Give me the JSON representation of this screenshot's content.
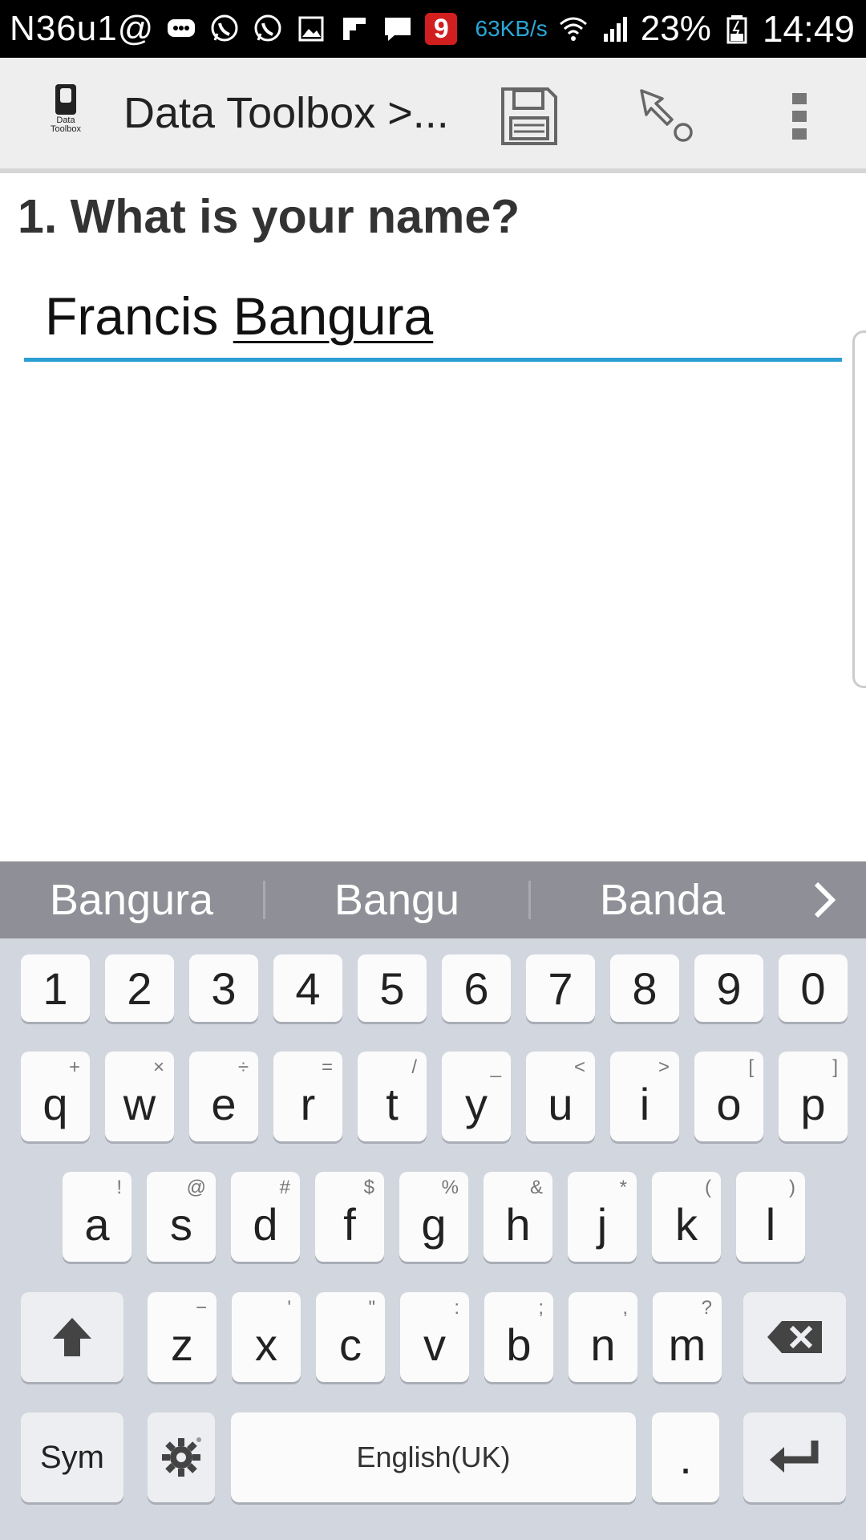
{
  "status_bar": {
    "carrier": "N36u1@",
    "net_speed": "63KB/s",
    "battery": "23%",
    "time": "14:49",
    "notif_badge": "9",
    "icons": [
      "chat-bubble-icon",
      "whatsapp-icon",
      "whatsapp-icon",
      "image-icon",
      "flipboard-icon",
      "message-icon",
      "app-9-icon",
      "wifi-icon",
      "signal-icon",
      "battery-icon"
    ]
  },
  "app_bar": {
    "logo_caption": "Data Toolbox",
    "title": "Data Toolbox >...",
    "actions": [
      "save-icon",
      "pointer-icon",
      "more-vert-icon"
    ]
  },
  "form": {
    "question": "1. What is your name?",
    "answer_first": "Francis",
    "answer_last": "Bangura",
    "accent_color": "#2b9fd3"
  },
  "suggestions": [
    "Bangura",
    "Bangu",
    "Banda"
  ],
  "keyboard": {
    "numbers": [
      "1",
      "2",
      "3",
      "4",
      "5",
      "6",
      "7",
      "8",
      "9",
      "0"
    ],
    "row1": [
      {
        "k": "q",
        "h": "+"
      },
      {
        "k": "w",
        "h": "×"
      },
      {
        "k": "e",
        "h": "÷"
      },
      {
        "k": "r",
        "h": "="
      },
      {
        "k": "t",
        "h": "/"
      },
      {
        "k": "y",
        "h": "_"
      },
      {
        "k": "u",
        "h": "<"
      },
      {
        "k": "i",
        "h": ">"
      },
      {
        "k": "o",
        "h": "["
      },
      {
        "k": "p",
        "h": "]"
      }
    ],
    "row2": [
      {
        "k": "a",
        "h": "!"
      },
      {
        "k": "s",
        "h": "@"
      },
      {
        "k": "d",
        "h": "#"
      },
      {
        "k": "f",
        "h": "$"
      },
      {
        "k": "g",
        "h": "%"
      },
      {
        "k": "h",
        "h": "&"
      },
      {
        "k": "j",
        "h": "*"
      },
      {
        "k": "k",
        "h": "("
      },
      {
        "k": "l",
        "h": ")"
      }
    ],
    "row3": [
      {
        "k": "z",
        "h": "−"
      },
      {
        "k": "x",
        "h": "'"
      },
      {
        "k": "c",
        "h": "\""
      },
      {
        "k": "v",
        "h": ":"
      },
      {
        "k": "b",
        "h": ";"
      },
      {
        "k": "n",
        "h": ","
      },
      {
        "k": "m",
        "h": "?"
      }
    ],
    "sym_label": "Sym",
    "space_label": "English(UK)",
    "period_label": "."
  }
}
